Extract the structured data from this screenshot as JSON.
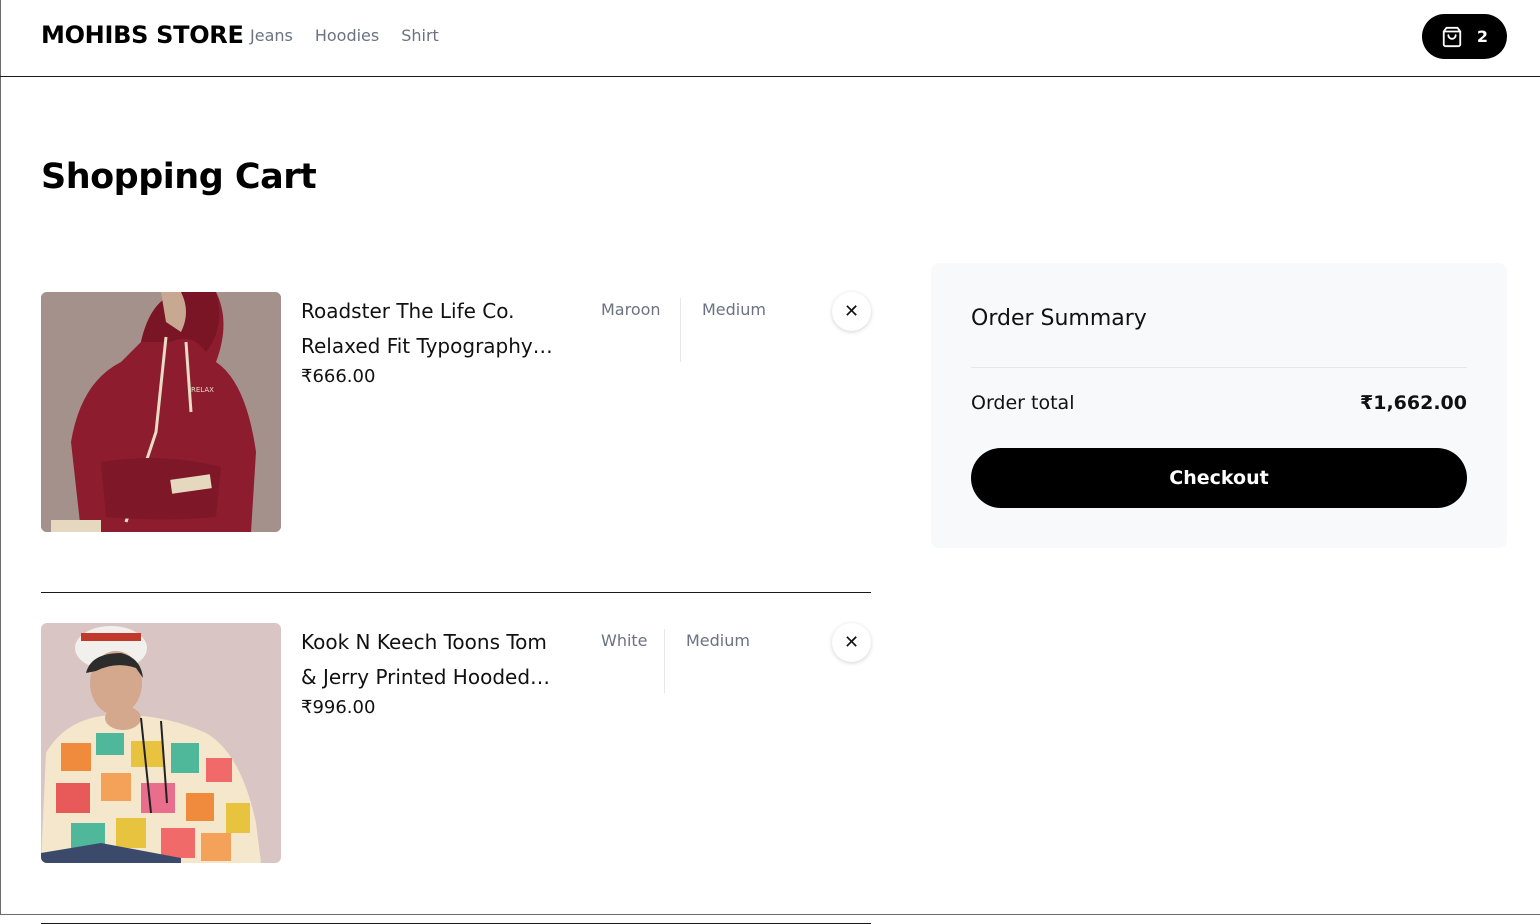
{
  "header": {
    "brand": "MOHIBS STORE",
    "nav": [
      "Jeans",
      "Hoodies",
      "Shirt"
    ],
    "cart_count": "2",
    "cart_icon": "shopping-bag-icon"
  },
  "page": {
    "title": "Shopping Cart"
  },
  "cart": {
    "items": [
      {
        "name": "Roadster The Life Co. Relaxed Fit Typography Hooded Sweatshirt",
        "price": "₹666.00",
        "color": "Maroon",
        "size": "Medium",
        "image": "maroon-hoodie-product-image",
        "remove_icon": "close-icon",
        "remove_glyph": "✕"
      },
      {
        "name": "Kook N Keech Toons Tom & Jerry Printed Hooded Sweatshirt",
        "price": "₹996.00",
        "color": "White",
        "size": "Medium",
        "image": "printed-hoodie-product-image",
        "remove_icon": "close-icon",
        "remove_glyph": "✕"
      }
    ]
  },
  "summary": {
    "title": "Order Summary",
    "total_label": "Order total",
    "total_value": "₹1,662.00",
    "checkout_label": "Checkout"
  },
  "colors": {
    "primary": "#000000",
    "muted_text": "#6b7280",
    "summary_bg": "#f8f9fb",
    "divider": "#e5e7eb"
  }
}
